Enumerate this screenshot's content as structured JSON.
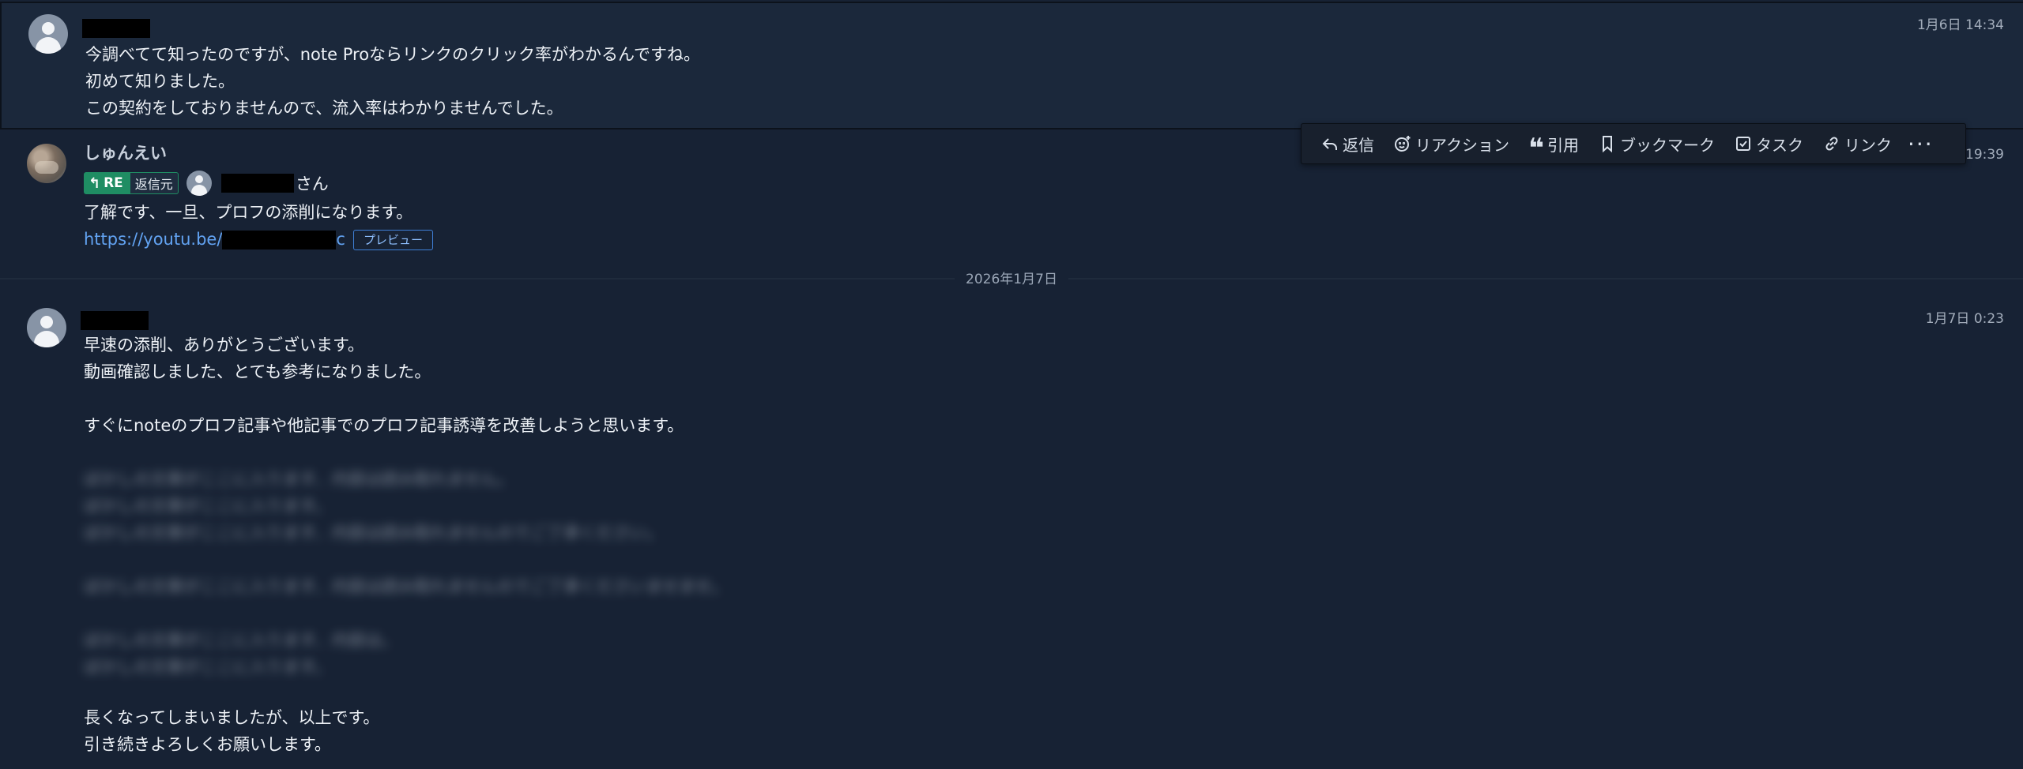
{
  "messages": [
    {
      "timestamp": "1月6日 14:34",
      "lines": [
        "今調べてて知ったのですが、note Proならリンクのクリック率がわかるんですね。",
        "初めて知りました。",
        "この契約をしておりませんので、流入率はわかりませんでした。"
      ]
    },
    {
      "author": "しゅんえい",
      "timestamp": "19:39",
      "reply_badge": "RE",
      "reply_origin_label": "返信元",
      "mention_suffix": "さん",
      "lines": [
        "了解です、一旦、プロフの添削になります。"
      ],
      "link_text": "https://youtu.be/",
      "link_tail": "c",
      "preview_label": "プレビュー"
    },
    {
      "timestamp": "1月7日 0:23",
      "lines": [
        "早速の添削、ありがとうございます。",
        "動画確認しました、とても参考になりました。",
        "すぐにnoteのプロフ記事や他記事でのプロフ記事誘導を改善しようと思います。"
      ],
      "blurred_lines": [
        "ぼかしの文章がここに入ります、内容は読み取れません。",
        "ぼかしの文章がここに入ります。",
        "ぼかしの文章がここに入ります、内容は読み取れませんのでご了承ください。",
        "ぼかしの文章がここに入ります、内容は読み取れませんのでご了承くださいませませ。",
        "ぼかしの文章がここに入ります、内容は。",
        "ぼかしの文章がここに入ります。"
      ],
      "closing_lines": [
        "長くなってしまいましたが、以上です。",
        "引き続きよろしくお願いします。"
      ]
    }
  ],
  "date_divider": "2026年1月7日",
  "toolbar": {
    "reply": "返信",
    "reaction": "リアクション",
    "quote": "引用",
    "bookmark": "ブックマーク",
    "task": "タスク",
    "link": "リンク",
    "more": "···"
  },
  "colors": {
    "background": "#172234",
    "highlight_row": "#1b283b",
    "link": "#62a3f2",
    "re_badge": "#1f8d63"
  }
}
